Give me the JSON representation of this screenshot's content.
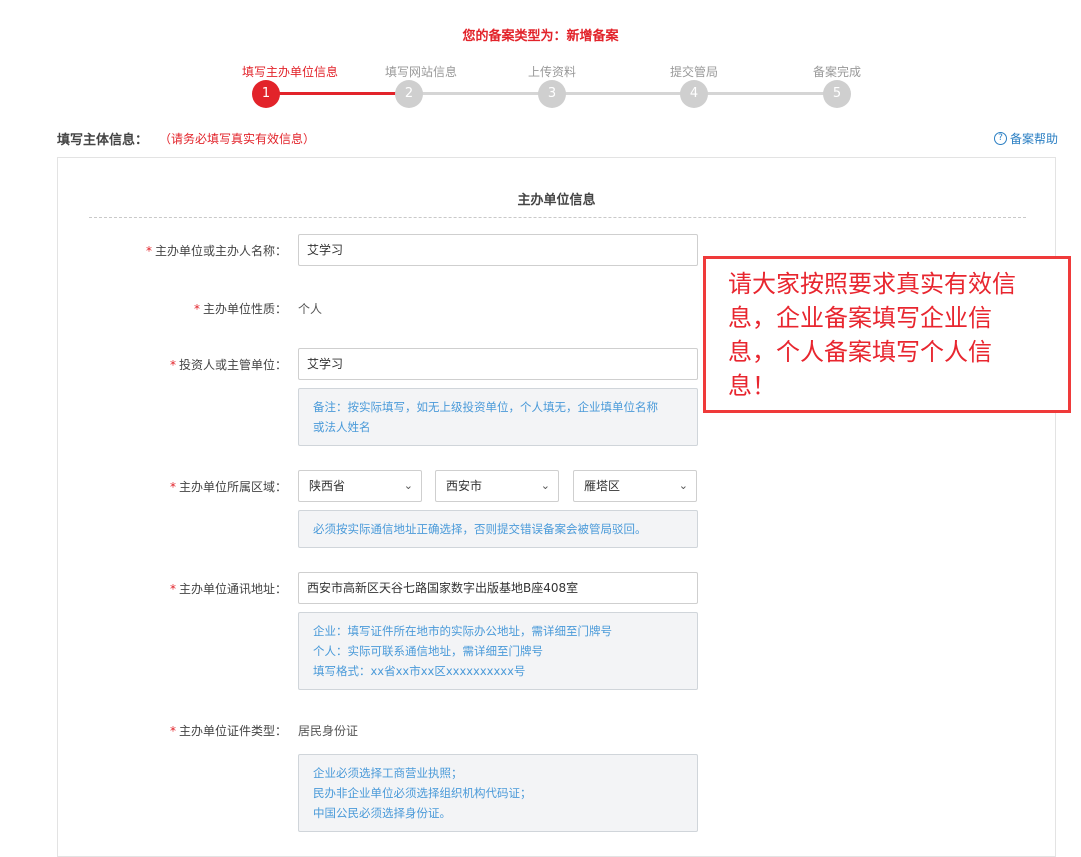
{
  "header": {
    "filing_type": "您的备案类型为：新增备案"
  },
  "steps": [
    {
      "number": "1",
      "label": "填写主办单位信息",
      "active": true
    },
    {
      "number": "2",
      "label": "填写网站信息",
      "active": false
    },
    {
      "number": "3",
      "label": "上传资料",
      "active": false
    },
    {
      "number": "4",
      "label": "提交管局",
      "active": false
    },
    {
      "number": "5",
      "label": "备案完成",
      "active": false
    }
  ],
  "section": {
    "title": "填写主体信息：",
    "warning": "（请务必填写真实有效信息）",
    "help_label": "备案帮助",
    "help_icon": "?"
  },
  "form": {
    "panel_title": "主办单位信息",
    "required_mark": "*",
    "org_name": {
      "label": "主办单位或主办人名称：",
      "value": "艾学习"
    },
    "org_nature": {
      "label": "主办单位性质：",
      "value": "个人"
    },
    "investor": {
      "label": "投资人或主管单位：",
      "value": "艾学习",
      "note": [
        "备注：按实际填写，如无上级投资单位，个人填无，企业填单位名称",
        "或法人姓名"
      ]
    },
    "region": {
      "label": "主办单位所属区域：",
      "province": "陕西省",
      "city": "西安市",
      "district": "雁塔区",
      "note": [
        "必须按实际通信地址正确选择，否则提交错误备案会被管局驳回。"
      ]
    },
    "address": {
      "label": "主办单位通讯地址：",
      "value": "西安市高新区天谷七路国家数字出版基地B座408室",
      "note": [
        "企业：填写证件所在地市的实际办公地址，需详细至门牌号",
        "个人：实际可联系通信地址，需详细至门牌号",
        "填写格式：xx省xx市xx区xxxxxxxxxx号"
      ]
    },
    "id_type": {
      "label": "主办单位证件类型：",
      "value": "居民身份证",
      "note": [
        "企业必须选择工商营业执照；",
        "民办非企业单位必须选择组织机构代码证；",
        "中国公民必须选择身份证。"
      ]
    }
  },
  "callout": {
    "lines": [
      "请大家按照要求真实有效信",
      "息，企业备案填写企业信",
      "息，个人备案填写个人信",
      "息！"
    ],
    "border_color": "#ef3a3a"
  },
  "colors": {
    "accent": "#e2232a",
    "link": "#2b7fc3",
    "note_text": "#4a9ad9"
  }
}
